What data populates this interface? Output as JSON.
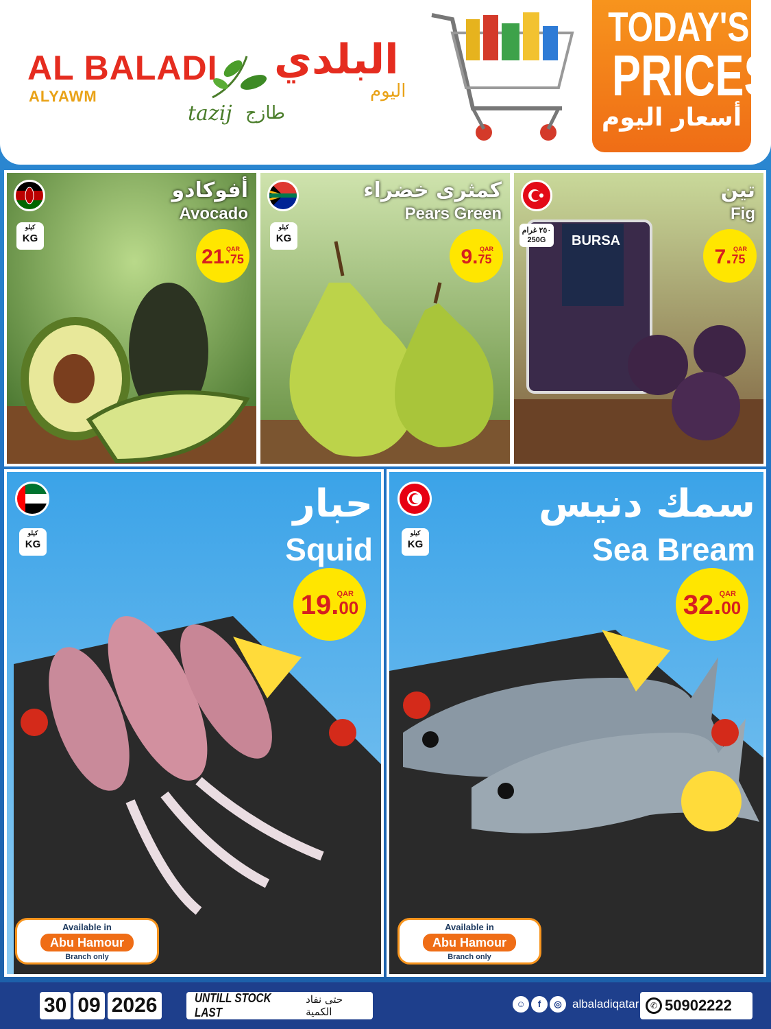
{
  "header": {
    "brand_en": "AL BALADI",
    "brand_sub_en": "ALYAWM",
    "brand_ar": "البلدي",
    "brand_sub_ar": "اليوم",
    "tagline_en": "tazij",
    "tagline_ar": "طازج",
    "promo_line1": "TODAY'S",
    "promo_line2": "PRICES",
    "promo_line3_ar": "أسعار اليوم"
  },
  "products": [
    {
      "name_ar": "أفوكادو",
      "name_en": "Avocado",
      "price_int": "21.",
      "price_dec": "75",
      "currency": "QAR",
      "unit_ar": "كيلو",
      "unit_en": "KG",
      "origin": "Kenya"
    },
    {
      "name_ar": "كمثرى خضراء",
      "name_en": "Pears Green",
      "price_int": "9.",
      "price_dec": "75",
      "currency": "QAR",
      "unit_ar": "كيلو",
      "unit_en": "KG",
      "origin": "South Africa"
    },
    {
      "name_ar": "تين",
      "name_en": "Fig",
      "price_int": "7.",
      "price_dec": "75",
      "currency": "QAR",
      "unit_ar": "٢٥٠ غرام",
      "unit_en": "250G",
      "origin": "Turkey",
      "pack_brand": "BURSA"
    },
    {
      "name_ar": "حبار",
      "name_en": "Squid",
      "price_int": "19.",
      "price_dec": "00",
      "currency": "QAR",
      "unit_ar": "كيلو",
      "unit_en": "KG",
      "origin": "UAE",
      "availability": {
        "line1": "Available in",
        "line2": "Abu Hamour",
        "line3": "Branch only"
      }
    },
    {
      "name_ar": "سمك دنيس",
      "name_en": "Sea Bream",
      "price_int": "32.",
      "price_dec": "00",
      "currency": "QAR",
      "unit_ar": "كيلو",
      "unit_en": "KG",
      "origin": "Tunisia",
      "availability": {
        "line1": "Available in",
        "line2": "Abu Hamour",
        "line3": "Branch only"
      }
    }
  ],
  "footer": {
    "date_day": "30",
    "date_month": "09",
    "date_year": "2026",
    "stock_en": "UNTILL STOCK LAST",
    "stock_ar": "حتى نفاد الكمية",
    "social_handle": "albaladiqatar",
    "phone": "50902222"
  },
  "colors": {
    "brand_red": "#e52c1f",
    "brand_orange": "#f7941d",
    "price_yellow": "#ffe600",
    "footer_blue": "#1e3f8c"
  }
}
